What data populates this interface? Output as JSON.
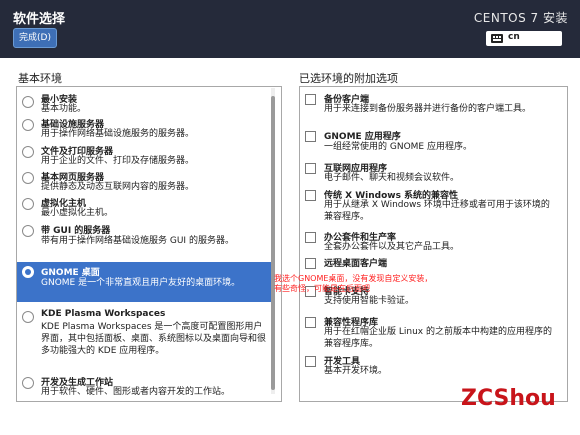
{
  "header": {
    "title": "软件选择",
    "done_label": "完成(D)",
    "os_title": "CENTOS 7 安装",
    "keyboard_layout": "cn"
  },
  "left_panel": {
    "title": "基本环境",
    "items": [
      {
        "title": "最小安装",
        "desc": "基本功能。",
        "selected": false
      },
      {
        "title": "基础设施服务器",
        "desc": "用于操作网络基础设施服务的服务器。",
        "selected": false
      },
      {
        "title": "文件及打印服务器",
        "desc": "用于企业的文件、打印及存储服务器。",
        "selected": false
      },
      {
        "title": "基本网页服务器",
        "desc": "提供静态及动态互联网内容的服务器。",
        "selected": false
      },
      {
        "title": "虚拟化主机",
        "desc": "最小虚拟化主机。",
        "selected": false
      },
      {
        "title": "带 GUI 的服务器",
        "desc": "带有用于操作网络基础设施服务 GUI 的服务器。",
        "selected": false
      },
      {
        "title": "GNOME 桌面",
        "desc": "GNOME 是一个非常直观且用户友好的桌面环境。",
        "selected": true
      },
      {
        "title": "KDE Plasma Workspaces",
        "desc": "KDE Plasma Workspaces 是一个高度可配置图形用户界面，其中包括面板、桌面、系统图标以及桌面向导和很多功能强大的 KDE 应用程序。",
        "selected": false
      },
      {
        "title": "开发及生成工作站",
        "desc": "用于软件、硬件、图形或者内容开发的工作站。",
        "selected": false
      }
    ]
  },
  "right_panel": {
    "title": "已选环境的附加选项",
    "items": [
      {
        "title": "备份客户端",
        "desc": "用于来连接到备份服务器并进行备份的客户端工具。",
        "checked": false
      },
      {
        "title": "GNOME 应用程序",
        "desc": "一组经常使用的 GNOME 应用程序。",
        "checked": false
      },
      {
        "title": "互联网应用程序",
        "desc": "电子邮件、聊天和视频会议软件。",
        "checked": false
      },
      {
        "title": "传统 X Windows 系统的兼容性",
        "desc": "用于从继承 X Windows 环境中迁移或者可用于该环境的兼容程序。",
        "checked": false
      },
      {
        "title": "办公套件和生产率",
        "desc": "全套办公套件以及其它产品工具。",
        "checked": false
      },
      {
        "title": "远程桌面客户端",
        "desc": "",
        "checked": false
      },
      {
        "title": "智能卡支持",
        "desc": "支持使用智能卡验证。",
        "checked": false
      },
      {
        "title": "兼容性程序库",
        "desc": "用于在红帽企业版 Linux 的之前版本中构建的应用程序的兼容程序库。",
        "checked": false
      },
      {
        "title": "开发工具",
        "desc": "基本开发环境。",
        "checked": false
      }
    ]
  },
  "annotation": {
    "line1": "我选个GNOME桌面，没有发现自定义安装，",
    "line2": "有些奇怪，可能是在后面吧"
  },
  "watermark": "ZCShou",
  "colors": {
    "header_bg": "#252a3a",
    "selection": "#3c73c9",
    "done_button": "#3e6fb6",
    "annotation": "#ff1f1f",
    "watermark": "#c8141a"
  }
}
